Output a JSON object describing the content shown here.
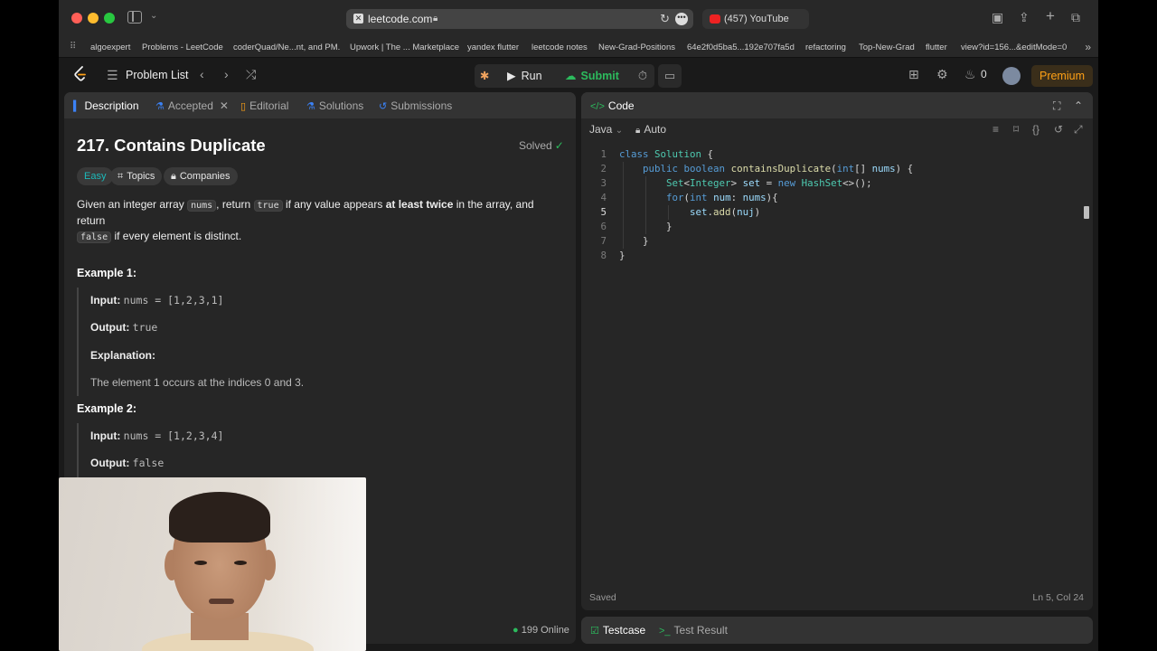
{
  "browser": {
    "url": "leetcode.com",
    "other_tab": "(457) YouTube"
  },
  "bookmarks": [
    "algoexpert",
    "Problems - LeetCode",
    "coderQuad/Ne...nt, and PM.",
    "Upwork | The ... Marketplace",
    "yandex flutter",
    "leetcode notes",
    "New-Grad-Positions",
    "64e2f0d5ba5...192e707fa5d",
    "refactoring",
    "Top-New-Grad",
    "flutter",
    "view?id=156...&editMode=0"
  ],
  "nav": {
    "problem_list": "Problem List",
    "run": "Run",
    "submit": "Submit",
    "streak": "0",
    "premium": "Premium"
  },
  "left_tabs": {
    "description": "Description",
    "accepted": "Accepted",
    "editorial": "Editorial",
    "solutions": "Solutions",
    "submissions": "Submissions"
  },
  "problem": {
    "title": "217. Contains Duplicate",
    "status": "Solved",
    "difficulty": "Easy",
    "topics": "Topics",
    "companies": "Companies",
    "desc_1": "Given an integer array ",
    "desc_code_nums": "nums",
    "desc_2": ", return ",
    "desc_code_true": "true",
    "desc_3": " if any value appears ",
    "desc_bold": "at least twice",
    "desc_4": " in the array, and return",
    "desc_code_false": "false",
    "desc_5": " if every element is distinct."
  },
  "examples": [
    {
      "heading": "Example 1:",
      "input_label": "Input:",
      "input": "nums = [1,2,3,1]",
      "output_label": "Output:",
      "output": "true",
      "explanation_label": "Explanation:",
      "explanation": "The element 1 occurs at the indices 0 and 3."
    },
    {
      "heading": "Example 2:",
      "input_label": "Input:",
      "input": "nums = [1,2,3,4]",
      "output_label": "Output:",
      "output": "false"
    }
  ],
  "online": "199 Online",
  "code_panel": {
    "title": "Code",
    "language": "Java",
    "mode": "Auto",
    "status": "Saved",
    "cursor": "Ln 5, Col 24",
    "lines": [
      "class Solution {",
      "    public boolean containsDuplicate(int[] nums) {",
      "        Set<Integer> set = new HashSet<>();",
      "        for(int num: nums){",
      "            set.add(nuj)",
      "        }",
      "    }",
      "}"
    ],
    "line_numbers": [
      "1",
      "2",
      "3",
      "4",
      "5",
      "6",
      "7",
      "8"
    ]
  },
  "bottom_tabs": {
    "testcase": "Testcase",
    "test_result": "Test Result"
  },
  "colors": {
    "accent_green": "#2cbb5d",
    "premium_orange": "#ffa116",
    "easy_teal": "#1cbaba"
  }
}
